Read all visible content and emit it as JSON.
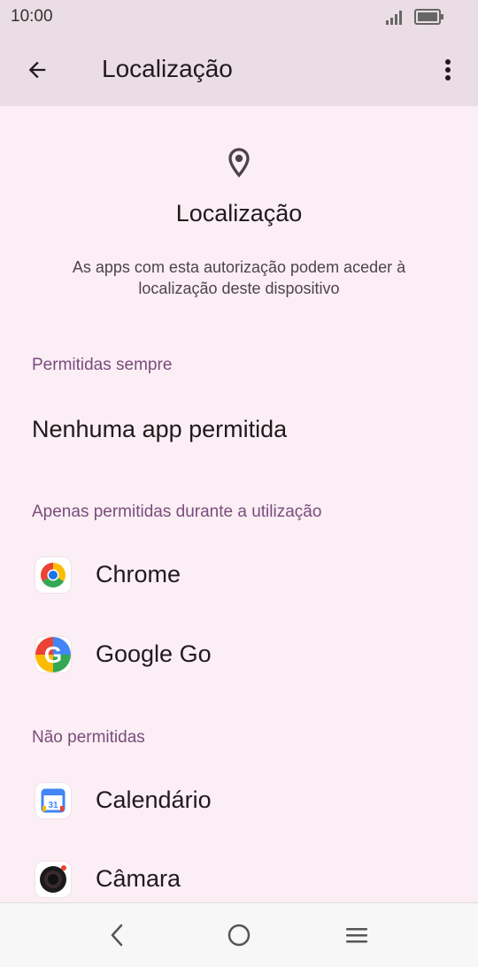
{
  "status": {
    "time": "10:00"
  },
  "appbar": {
    "title": "Localização"
  },
  "header": {
    "title": "Localização",
    "description": "As apps com esta autorização podem aceder à localização deste dispositivo"
  },
  "sections": {
    "always": {
      "label": "Permitidas sempre",
      "empty": "Nenhuma app permitida"
    },
    "while_using": {
      "label": "Apenas permitidas durante a utilização",
      "apps": [
        {
          "name": "Chrome",
          "icon": "chrome-icon"
        },
        {
          "name": "Google Go",
          "icon": "google-go-icon"
        }
      ]
    },
    "denied": {
      "label": "Não permitidas",
      "apps": [
        {
          "name": "Calendário",
          "icon": "calendar-icon",
          "icon_text": "31"
        },
        {
          "name": "Câmara",
          "icon": "camera-icon"
        }
      ]
    }
  },
  "colors": {
    "accent": "#7a4c7e",
    "background": "#fbeef4",
    "appbar": "#ebdde4"
  }
}
